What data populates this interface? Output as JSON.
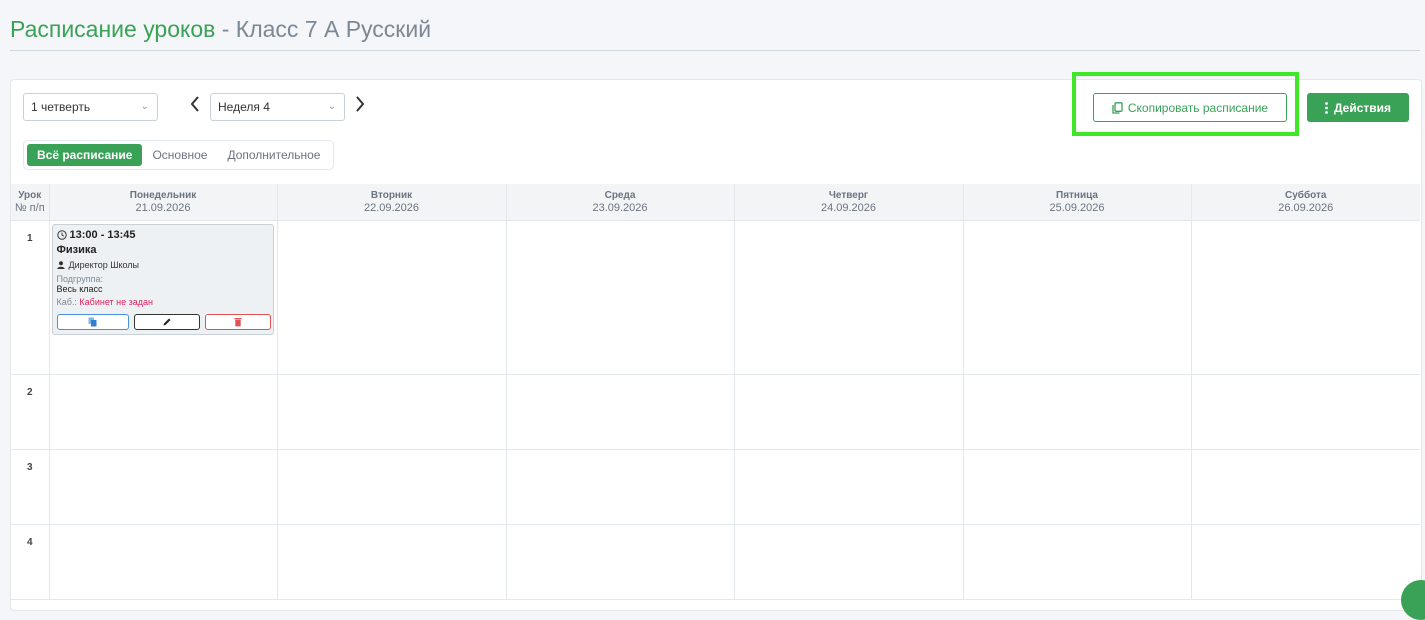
{
  "page": {
    "title_accent": "Расписание уроков",
    "title_rest": " - Класс 7 А Русский"
  },
  "filters": {
    "quarter": "1 четверть",
    "week": "Неделя 4"
  },
  "tabs": [
    {
      "label": "Всё расписание",
      "active": true
    },
    {
      "label": "Основное",
      "active": false
    },
    {
      "label": "Дополнительное",
      "active": false
    }
  ],
  "actions": {
    "copy_label": "Скопировать расписание",
    "actions_label": "Действия"
  },
  "grid": {
    "lesson_col_line1": "Урок",
    "lesson_col_line2": "№ п/п",
    "days": [
      {
        "name": "Понедельник",
        "date": "21.09.2026"
      },
      {
        "name": "Вторник",
        "date": "22.09.2026"
      },
      {
        "name": "Среда",
        "date": "23.09.2026"
      },
      {
        "name": "Четверг",
        "date": "24.09.2026"
      },
      {
        "name": "Пятница",
        "date": "25.09.2026"
      },
      {
        "name": "Суббота",
        "date": "26.09.2026"
      }
    ],
    "rows": [
      "1",
      "2",
      "3",
      "4"
    ]
  },
  "lesson": {
    "time": "13:00 - 13:45",
    "subject": "Физика",
    "teacher": "Директор Школы",
    "subgroup_label": "Подгруппа:",
    "subgroup_value": "Весь класс",
    "room_label": "Каб.:",
    "room_value": "Кабинет не задан"
  },
  "colors": {
    "accent": "#3aa257",
    "highlight": "#3ee826",
    "warning": "#e0245e"
  }
}
